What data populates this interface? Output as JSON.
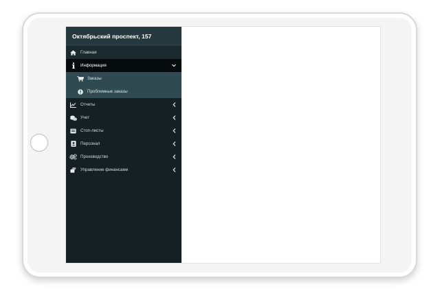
{
  "sidebar": {
    "title": "Октябрьский проспект, 157",
    "items": [
      {
        "label": "Главная",
        "icon": "home-icon"
      },
      {
        "label": "Информация",
        "icon": "info-icon",
        "expanded": true
      },
      {
        "label": "Отчеты",
        "icon": "chart-icon"
      },
      {
        "label": "Учет",
        "icon": "coins-icon"
      },
      {
        "label": "Стоп-листы",
        "icon": "list-icon"
      },
      {
        "label": "Персонал",
        "icon": "person-badge-icon"
      },
      {
        "label": "Производство",
        "icon": "gears-icon"
      },
      {
        "label": "Управление финансами",
        "icon": "finance-icon"
      }
    ],
    "submenu": [
      {
        "label": "Заказы",
        "icon": "cart-icon"
      },
      {
        "label": "Проблемные заказы",
        "icon": "alert-icon"
      }
    ]
  },
  "colors": {
    "sidebar_bg": "#142024",
    "header_bg": "#26393f",
    "active_bg": "#050a0c",
    "submenu_bg": "#2f4a50"
  }
}
